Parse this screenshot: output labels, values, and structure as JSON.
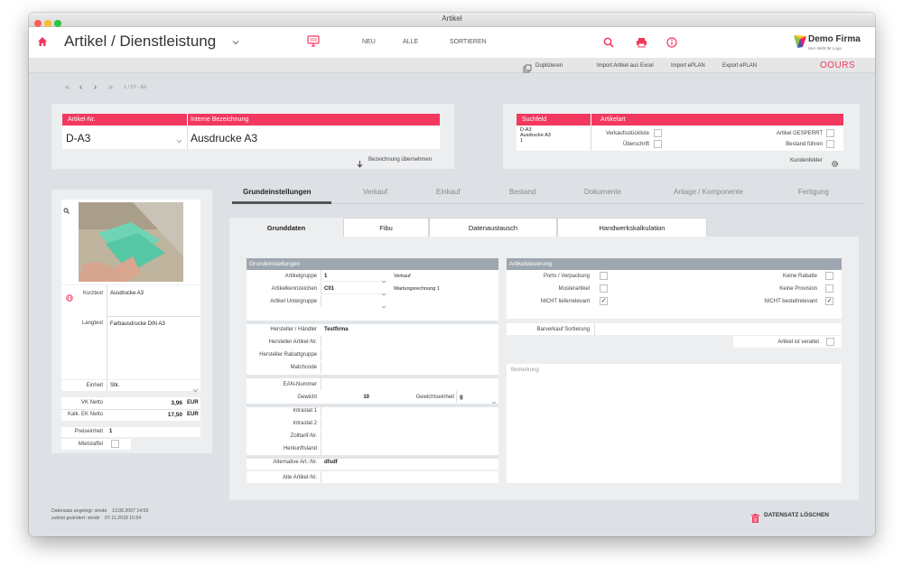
{
  "window": {
    "title": "Artikel",
    "colors": {
      "close": "#fd5f57",
      "minimize": "#fdbc2e",
      "zoom": "#28c840"
    }
  },
  "header": {
    "page_title": "Artikel / Dienstleistung",
    "nav": {
      "new": "NEU",
      "all": "ALLE",
      "sort": "SORTIEREN"
    },
    "logo": {
      "name": "Demo Firma",
      "tagline": "Hier steht Ihr Logo"
    },
    "accent": "#f2385f"
  },
  "subbar": {
    "duplicate": "Duplizieren",
    "import_excel": "Import Artikel aus Excel",
    "import_eplan": "Import ePLAN",
    "export_eplan": "Export ePLAN",
    "brand": "OOURS"
  },
  "pager": {
    "position": "1 / 57 - 60"
  },
  "top_left": {
    "article_no_label": "Artikel-Nr.",
    "internal_name_label": "Interne Bezeichnung",
    "article_no": "D-A3",
    "internal_name": "Ausdrucke A3",
    "take_over": "Bezeichnung übernehmen"
  },
  "top_right": {
    "search_label": "Suchfeld",
    "type_label": "Artikelart",
    "search_lines": [
      "D-A3",
      "Ausdrucke A3",
      "1"
    ],
    "sales_bom": "Verkaufsstückliste",
    "heading": "Überschrift",
    "blocked": "Artikel GESPERRT",
    "manage_stock": "Bestand führen",
    "customer_fields": "Kundenfelder"
  },
  "left": {
    "short_label": "Kurztext",
    "short_value": "Ausdrucke A3",
    "long_label": "Langtext",
    "long_value": "Farbausdrucke DIN A3",
    "unit_label": "Einheit",
    "unit_value": "Stk.",
    "vk_label": "VK Netto",
    "vk_value": "3,96",
    "ek_label": "Kalk. EK Netto",
    "ek_value": "17,50",
    "currency": "EUR",
    "price_unit_label": "Preiseinheit",
    "price_unit_value": "1",
    "rental_label": "Mietstaffel"
  },
  "tabs": [
    "Grundeinstellungen",
    "Verkauf",
    "Einkauf",
    "Bestand",
    "Dokumente",
    "Anlage / Komponente",
    "Fertigung"
  ],
  "subtabs": [
    "Grunddaten",
    "Fibu",
    "Datenaustausch",
    "Handwerkskalkulation"
  ],
  "basic": {
    "section": "Grundeinstellungen",
    "group_label": "Artikelgruppe",
    "group_value": "1",
    "group_desc": "Verkauf",
    "code_label": "Artikelkennzeichen",
    "code_value": "C01",
    "code_desc": "Wartungsrechnung 1",
    "subgroup_label": "Artikel Untergruppe",
    "maker_label": "Hersteller / Händler",
    "maker_value": "Testfirma",
    "maker_no_label": "Hersteller Artikel-Nr.",
    "maker_rebate_label": "Hersteller Rabattgruppe",
    "matchcode_label": "Matchcode",
    "ean_label": "EAN-Nummer",
    "weight_label": "Gewicht",
    "weight_value": "10",
    "weight_unit_label": "Gewichtseinheit",
    "weight_unit_value": "g",
    "intrastat1_label": "Intrastat 1",
    "intrastat2_label": "Intrastat 2",
    "customs_label": "Zolltarif-Nr.",
    "origin_label": "Herkunftsland",
    "alt_no_label": "Alternative Art.-Nr.",
    "alt_no_value": "dfsdf",
    "old_no_label": "Alte Artikel-Nr."
  },
  "control": {
    "section": "Artikelsteuerung",
    "porto": "Porto / Verpackung",
    "sample": "Musterartikel",
    "not_deliverable": "NICHT lieferrelevant",
    "no_discount": "Keine Rabatte",
    "no_commission": "Keine Provision",
    "not_orderable": "NICHT bestellrelevant",
    "cash_sort": "Barverkauf Sortierung",
    "obsolete": "Artikel ist veraltet",
    "remark": "Bemerkung"
  },
  "footer": {
    "created_label": "Datensatz angelegt:",
    "created_user": "sinobi",
    "created_date": "13.08.2007 14:55",
    "changed_label": "zuletzt geändert:",
    "changed_user": "sinobi",
    "changed_date": "07.11.2018 15:54",
    "delete": "DATENSATZ LÖSCHEN"
  }
}
